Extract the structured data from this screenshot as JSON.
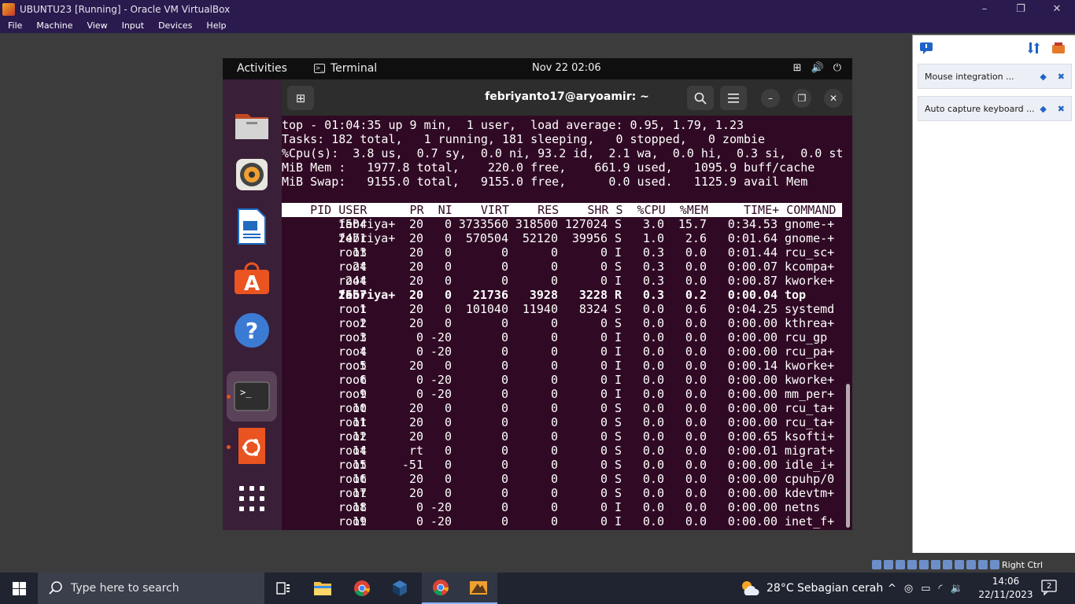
{
  "window": {
    "title": "UBUNTU23 [Running] - Oracle VM VirtualBox",
    "controls": [
      "–",
      "❐",
      "✕"
    ],
    "menu": [
      "File",
      "Machine",
      "View",
      "Input",
      "Devices",
      "Help"
    ]
  },
  "guest": {
    "topbar": {
      "activities": "Activities",
      "app_name": "Terminal",
      "clock": "Nov 22  02:06"
    },
    "terminal": {
      "title": "febriyanto17@aryoamir: ~",
      "summary": [
        "top - 01:04:35 up 9 min,  1 user,  load average: 0.95, 1.79, 1.23",
        "Tasks: 182 total,   1 running, 181 sleeping,   0 stopped,   0 zombie",
        "%Cpu(s):  3.8 us,  0.7 sy,  0.0 ni, 93.2 id,  2.1 wa,  0.0 hi,  0.3 si,  0.0 st",
        "MiB Mem :   1977.8 total,    220.0 free,    661.9 used,   1095.9 buff/cache",
        "MiB Swap:   9155.0 total,   9155.0 free,      0.0 used.   1125.9 avail Mem"
      ],
      "header": "    PID USER      PR  NI    VIRT    RES    SHR S  %CPU  %MEM     TIME+ COMMAND   ",
      "processes": [
        {
          "pid": "1504",
          "user": "febriya+",
          "pr": "20",
          "ni": "0",
          "virt": "3733560",
          "res": "318500",
          "shr": "127024",
          "s": "S",
          "cpu": "3.0",
          "mem": "15.7",
          "time": "0:34.53",
          "cmd": "gnome-+"
        },
        {
          "pid": "2471",
          "user": "febriya+",
          "pr": "20",
          "ni": "0",
          "virt": "570504",
          "res": "52120",
          "shr": "39956",
          "s": "S",
          "cpu": "1.0",
          "mem": "2.6",
          "time": "0:01.64",
          "cmd": "gnome-+"
        },
        {
          "pid": "13",
          "user": "root",
          "pr": "20",
          "ni": "0",
          "virt": "0",
          "res": "0",
          "shr": "0",
          "s": "I",
          "cpu": "0.3",
          "mem": "0.0",
          "time": "0:01.44",
          "cmd": "rcu_sc+"
        },
        {
          "pid": "24",
          "user": "root",
          "pr": "20",
          "ni": "0",
          "virt": "0",
          "res": "0",
          "shr": "0",
          "s": "S",
          "cpu": "0.3",
          "mem": "0.0",
          "time": "0:00.07",
          "cmd": "kcompa+"
        },
        {
          "pid": "244",
          "user": "root",
          "pr": "20",
          "ni": "0",
          "virt": "0",
          "res": "0",
          "shr": "0",
          "s": "I",
          "cpu": "0.3",
          "mem": "0.0",
          "time": "0:00.87",
          "cmd": "kworke+"
        },
        {
          "pid": "2557",
          "user": "febriya+",
          "pr": "20",
          "ni": "0",
          "virt": "21736",
          "res": "3928",
          "shr": "3228",
          "s": "R",
          "cpu": "0.3",
          "mem": "0.2",
          "time": "0:00.04",
          "cmd": "top",
          "bold": true
        },
        {
          "pid": "1",
          "user": "root",
          "pr": "20",
          "ni": "0",
          "virt": "101040",
          "res": "11940",
          "shr": "8324",
          "s": "S",
          "cpu": "0.0",
          "mem": "0.6",
          "time": "0:04.25",
          "cmd": "systemd"
        },
        {
          "pid": "2",
          "user": "root",
          "pr": "20",
          "ni": "0",
          "virt": "0",
          "res": "0",
          "shr": "0",
          "s": "S",
          "cpu": "0.0",
          "mem": "0.0",
          "time": "0:00.00",
          "cmd": "kthrea+"
        },
        {
          "pid": "3",
          "user": "root",
          "pr": "0",
          "ni": "-20",
          "virt": "0",
          "res": "0",
          "shr": "0",
          "s": "I",
          "cpu": "0.0",
          "mem": "0.0",
          "time": "0:00.00",
          "cmd": "rcu_gp"
        },
        {
          "pid": "4",
          "user": "root",
          "pr": "0",
          "ni": "-20",
          "virt": "0",
          "res": "0",
          "shr": "0",
          "s": "I",
          "cpu": "0.0",
          "mem": "0.0",
          "time": "0:00.00",
          "cmd": "rcu_pa+"
        },
        {
          "pid": "5",
          "user": "root",
          "pr": "20",
          "ni": "0",
          "virt": "0",
          "res": "0",
          "shr": "0",
          "s": "I",
          "cpu": "0.0",
          "mem": "0.0",
          "time": "0:00.14",
          "cmd": "kworke+"
        },
        {
          "pid": "6",
          "user": "root",
          "pr": "0",
          "ni": "-20",
          "virt": "0",
          "res": "0",
          "shr": "0",
          "s": "I",
          "cpu": "0.0",
          "mem": "0.0",
          "time": "0:00.00",
          "cmd": "kworke+"
        },
        {
          "pid": "9",
          "user": "root",
          "pr": "0",
          "ni": "-20",
          "virt": "0",
          "res": "0",
          "shr": "0",
          "s": "I",
          "cpu": "0.0",
          "mem": "0.0",
          "time": "0:00.00",
          "cmd": "mm_per+"
        },
        {
          "pid": "10",
          "user": "root",
          "pr": "20",
          "ni": "0",
          "virt": "0",
          "res": "0",
          "shr": "0",
          "s": "S",
          "cpu": "0.0",
          "mem": "0.0",
          "time": "0:00.00",
          "cmd": "rcu_ta+"
        },
        {
          "pid": "11",
          "user": "root",
          "pr": "20",
          "ni": "0",
          "virt": "0",
          "res": "0",
          "shr": "0",
          "s": "S",
          "cpu": "0.0",
          "mem": "0.0",
          "time": "0:00.00",
          "cmd": "rcu_ta+"
        },
        {
          "pid": "12",
          "user": "root",
          "pr": "20",
          "ni": "0",
          "virt": "0",
          "res": "0",
          "shr": "0",
          "s": "S",
          "cpu": "0.0",
          "mem": "0.0",
          "time": "0:00.65",
          "cmd": "ksofti+"
        },
        {
          "pid": "14",
          "user": "root",
          "pr": "rt",
          "ni": "0",
          "virt": "0",
          "res": "0",
          "shr": "0",
          "s": "S",
          "cpu": "0.0",
          "mem": "0.0",
          "time": "0:00.01",
          "cmd": "migrat+"
        },
        {
          "pid": "15",
          "user": "root",
          "pr": "-51",
          "ni": "0",
          "virt": "0",
          "res": "0",
          "shr": "0",
          "s": "S",
          "cpu": "0.0",
          "mem": "0.0",
          "time": "0:00.00",
          "cmd": "idle_i+"
        },
        {
          "pid": "16",
          "user": "root",
          "pr": "20",
          "ni": "0",
          "virt": "0",
          "res": "0",
          "shr": "0",
          "s": "S",
          "cpu": "0.0",
          "mem": "0.0",
          "time": "0:00.00",
          "cmd": "cpuhp/0"
        },
        {
          "pid": "17",
          "user": "root",
          "pr": "20",
          "ni": "0",
          "virt": "0",
          "res": "0",
          "shr": "0",
          "s": "S",
          "cpu": "0.0",
          "mem": "0.0",
          "time": "0:00.00",
          "cmd": "kdevtm+"
        },
        {
          "pid": "18",
          "user": "root",
          "pr": "0",
          "ni": "-20",
          "virt": "0",
          "res": "0",
          "shr": "0",
          "s": "I",
          "cpu": "0.0",
          "mem": "0.0",
          "time": "0:00.00",
          "cmd": "netns"
        },
        {
          "pid": "19",
          "user": "root",
          "pr": "0",
          "ni": "-20",
          "virt": "0",
          "res": "0",
          "shr": "0",
          "s": "I",
          "cpu": "0.0",
          "mem": "0.0",
          "time": "0:00.00",
          "cmd": "inet_f+"
        }
      ]
    },
    "dock": [
      "files-icon",
      "rhythmbox-icon",
      "writer-icon",
      "app-center-icon",
      "help-icon",
      "terminal-icon",
      "ubuntu-icon",
      "show-apps-icon"
    ]
  },
  "side_panel": {
    "notices": [
      "Mouse integration ...",
      "Auto capture keyboard ..."
    ]
  },
  "vb_status": {
    "host_key": "Right Ctrl"
  },
  "taskbar": {
    "search_placeholder": "Type here to search",
    "weather": "28°C  Sebagian cerah",
    "time": "14:06",
    "date": "22/11/2023",
    "notifications": "2"
  },
  "colors": {
    "terminal_bg": "#300a24",
    "ubuntu_orange": "#e95420",
    "vbox_title": "#2a1a4e",
    "taskbar": "#1f2430"
  }
}
